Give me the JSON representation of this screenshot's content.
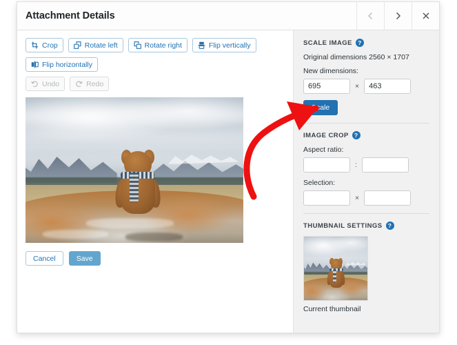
{
  "modal": {
    "title": "Attachment Details",
    "nav": {
      "prev_icon": "chevron-left-icon",
      "next_icon": "chevron-right-icon",
      "close_icon": "close-icon"
    }
  },
  "editor": {
    "toolbar": [
      {
        "label": "Crop",
        "icon": "crop-icon",
        "disabled": false
      },
      {
        "label": "Rotate left",
        "icon": "rotate-left-icon",
        "disabled": false
      },
      {
        "label": "Rotate right",
        "icon": "rotate-right-icon",
        "disabled": false
      },
      {
        "label": "Flip vertically",
        "icon": "flip-vertical-icon",
        "disabled": false
      },
      {
        "label": "Flip horizontally",
        "icon": "flip-horizontal-icon",
        "disabled": false
      }
    ],
    "history": [
      {
        "label": "Undo",
        "icon": "undo-icon",
        "disabled": true
      },
      {
        "label": "Redo",
        "icon": "redo-icon",
        "disabled": true
      }
    ],
    "image_alt": "Teddy bear sitting on a rock facing a mountain valley",
    "actions": {
      "cancel_label": "Cancel",
      "save_label": "Save",
      "save_disabled": true
    }
  },
  "sidebar": {
    "scale": {
      "title": "SCALE IMAGE",
      "help_icon": "help-icon",
      "original_dimensions": "Original dimensions 2560 × 1707",
      "new_dimensions_label": "New dimensions:",
      "width_value": "695",
      "height_value": "463",
      "separator": "×",
      "scale_button": "Scale"
    },
    "crop": {
      "title": "IMAGE CROP",
      "help_icon": "help-icon",
      "aspect_label": "Aspect ratio:",
      "aspect_separator": ":",
      "aspect_width": "",
      "aspect_height": "",
      "selection_label": "Selection:",
      "selection_separator": "×",
      "selection_width": "",
      "selection_height": ""
    },
    "thumbnail": {
      "title": "THUMBNAIL SETTINGS",
      "help_icon": "help-icon",
      "caption": "Current thumbnail"
    }
  },
  "annotation": {
    "arrow_icon": "red-curved-arrow-icon",
    "color": "#ee1111",
    "points_to": "Scale"
  },
  "colors": {
    "accent": "#2271b1",
    "button_border": "#a7c7de",
    "sidebar_bg": "#f1f1f1",
    "annotation_red": "#ee1111",
    "save_disabled": "#63a6cd"
  }
}
